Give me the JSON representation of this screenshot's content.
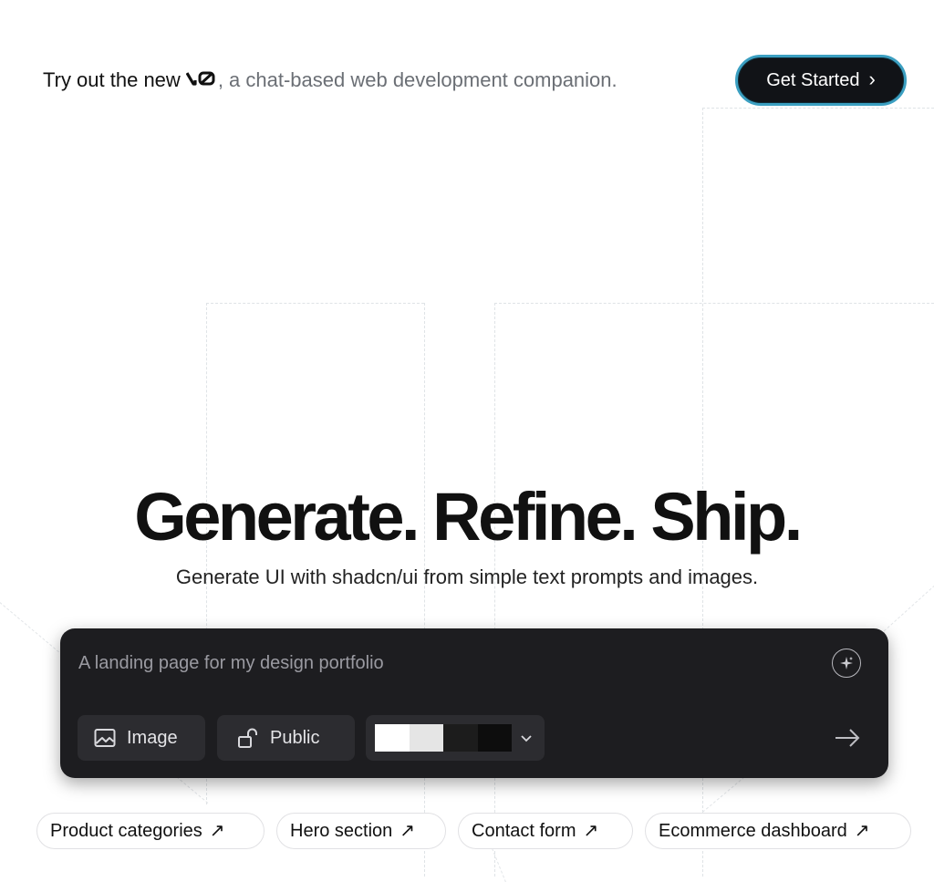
{
  "announcement": {
    "lead": "Try out the new",
    "logo": "v0",
    "rest": ", a chat-based web development companion.",
    "cta_label": "Get Started",
    "cta_icon": "chevron-right-icon",
    "cta_border_color": "#3b9fc1"
  },
  "hero": {
    "title": "Generate. Refine. Ship.",
    "subtitle": "Generate UI with shadcn/ui from simple text prompts and images."
  },
  "prompt": {
    "placeholder": "A landing page for my design portfolio",
    "enhance_icon": "sparkles-icon",
    "image_label": "Image",
    "image_icon": "image-icon",
    "visibility_label": "Public",
    "visibility_icon": "unlock-icon",
    "theme_swatches": [
      "#ffffff",
      "#e5e5e5",
      "#1c1c1c",
      "#0d0d0d"
    ],
    "theme_icon": "chevron-down-icon",
    "send_icon": "arrow-right-icon"
  },
  "suggestions": [
    {
      "label": "Product categories"
    },
    {
      "label": "Hero section"
    },
    {
      "label": "Contact form"
    },
    {
      "label": "Ecommerce dashboard"
    }
  ],
  "suggestion_icon": "arrow-up-right-icon"
}
